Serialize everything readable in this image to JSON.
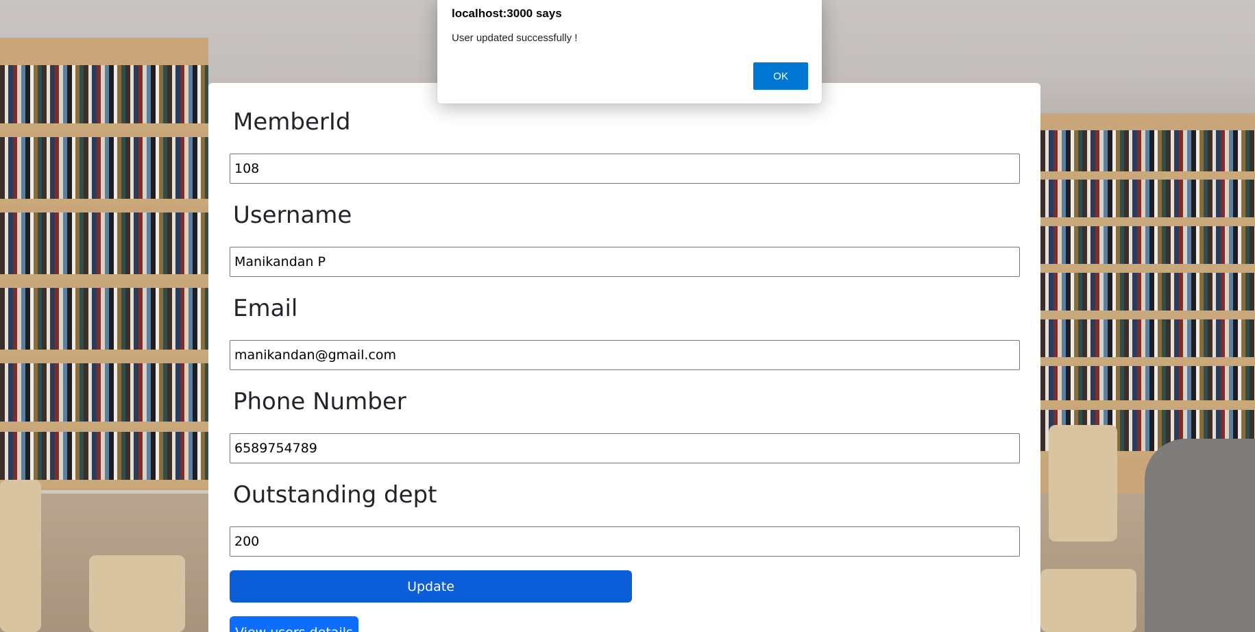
{
  "form": {
    "fields": [
      {
        "label": "MemberId",
        "value": "108"
      },
      {
        "label": "Username",
        "value": "Manikandan P"
      },
      {
        "label": "Email",
        "value": "manikandan@gmail.com"
      },
      {
        "label": "Phone Number",
        "value": "6589754789"
      },
      {
        "label": "Outstanding dept",
        "value": "200"
      }
    ],
    "update_label": "Update",
    "view_label": "View users details"
  },
  "dialog": {
    "title": "localhost:3000 says",
    "message": "User updated successfully !",
    "ok_label": "OK"
  },
  "colors": {
    "primary_button": "#0b5ed7",
    "dialog_ok": "#0078d4",
    "card_bg": "#ffffff"
  }
}
